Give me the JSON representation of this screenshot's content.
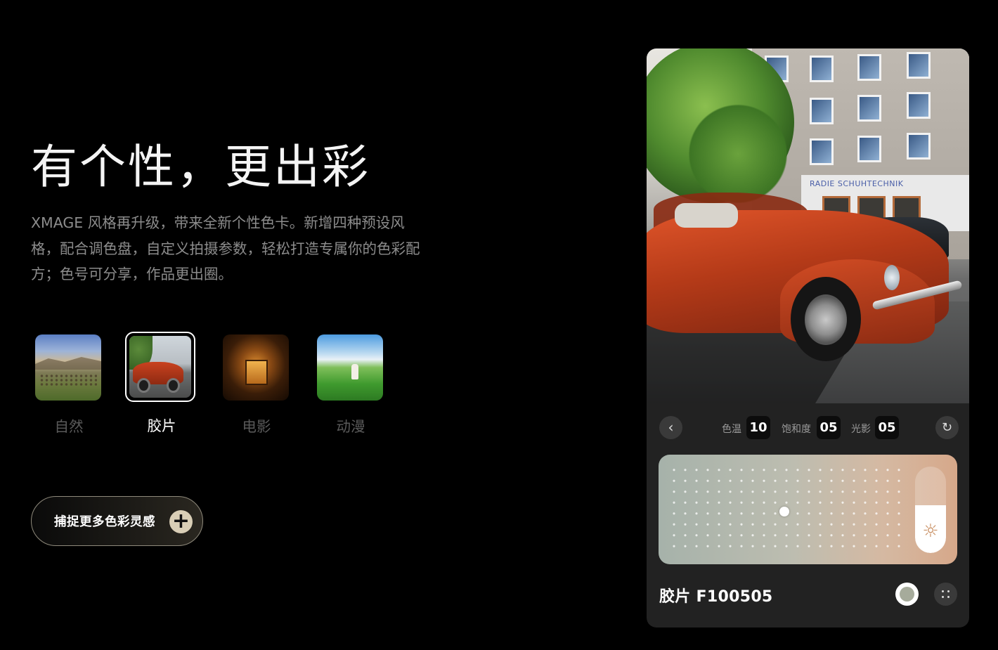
{
  "hero": {
    "title": "有个性，更出彩",
    "description": "XMAGE 风格再升级，带来全新个性色卡。新增四种预设风格，配合调色盘，自定义拍摄参数，轻松打造专属你的色彩配方；色号可分享，作品更出圈。"
  },
  "filters": [
    {
      "label": "自然",
      "selected": false
    },
    {
      "label": "胶片",
      "selected": true
    },
    {
      "label": "电影",
      "selected": false
    },
    {
      "label": "动漫",
      "selected": false
    }
  ],
  "cta": {
    "label": "捕捉更多色彩灵感",
    "icon": "plus-icon"
  },
  "editor": {
    "params": [
      {
        "label": "色温",
        "value": "10"
      },
      {
        "label": "饱和度",
        "value": "05"
      },
      {
        "label": "光影",
        "value": "05"
      }
    ],
    "preset_name": "胶片 F100505",
    "swatch_color": "#a6ab9b",
    "back_icon": "chevron-left-icon",
    "reset_icon": "reset-icon",
    "brightness_icon": "sun-icon",
    "more_icon": "grid-dots-icon",
    "photo_sign": "RADIE SCHUHTECHNIK",
    "brightness_level": 0.55
  },
  "colors": {
    "background": "#000000",
    "accent": "#d9ceb6",
    "panel": "#222222"
  }
}
